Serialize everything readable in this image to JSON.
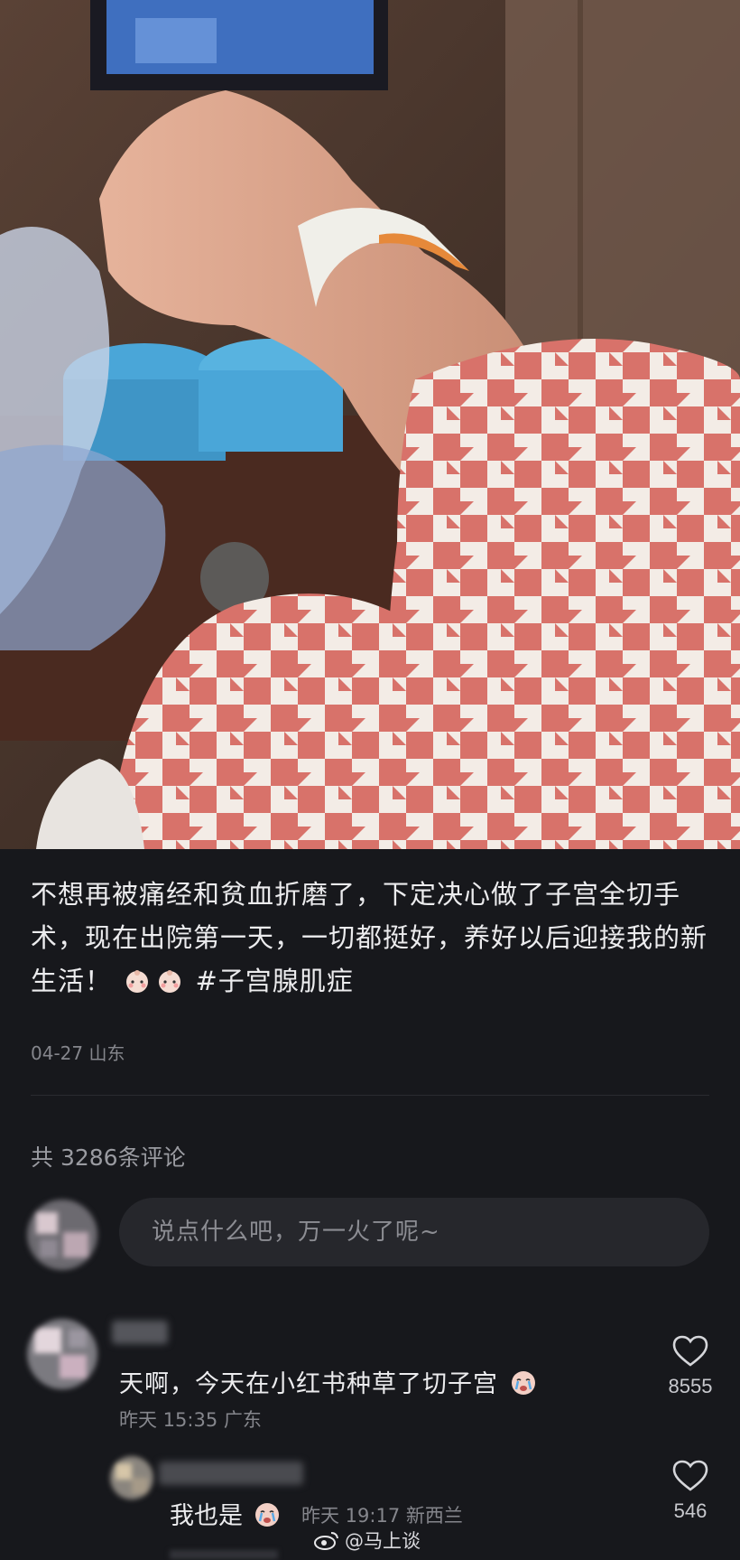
{
  "post": {
    "text_main": "不想再被痛经和贫血折磨了，下定决心做了子宫全切手术，现在出院第一天，一切都挺好，养好以后迎接我的新生活！",
    "hashtag": "#子宫腺肌症",
    "meta": "04-27 山东"
  },
  "comments_header": {
    "count_label": "共 3286条评论"
  },
  "comment_input": {
    "placeholder": "说点什么吧，万一火了呢~"
  },
  "comments": [
    {
      "text": "天啊，今天在小红书种草了切子宫",
      "meta": "昨天 15:35 广东",
      "likes": "8555"
    },
    {
      "text": "我也是",
      "meta": "昨天 19:17 新西兰",
      "likes": "546"
    }
  ],
  "watermark": {
    "text": "@马上谈"
  },
  "icons": {
    "like": "heart-icon",
    "emoji": "crying-face-icon",
    "weibo": "weibo-logo-icon"
  },
  "colors": {
    "background": "#17181c",
    "muted_text": "#85868c",
    "input_bg": "#26272c"
  }
}
